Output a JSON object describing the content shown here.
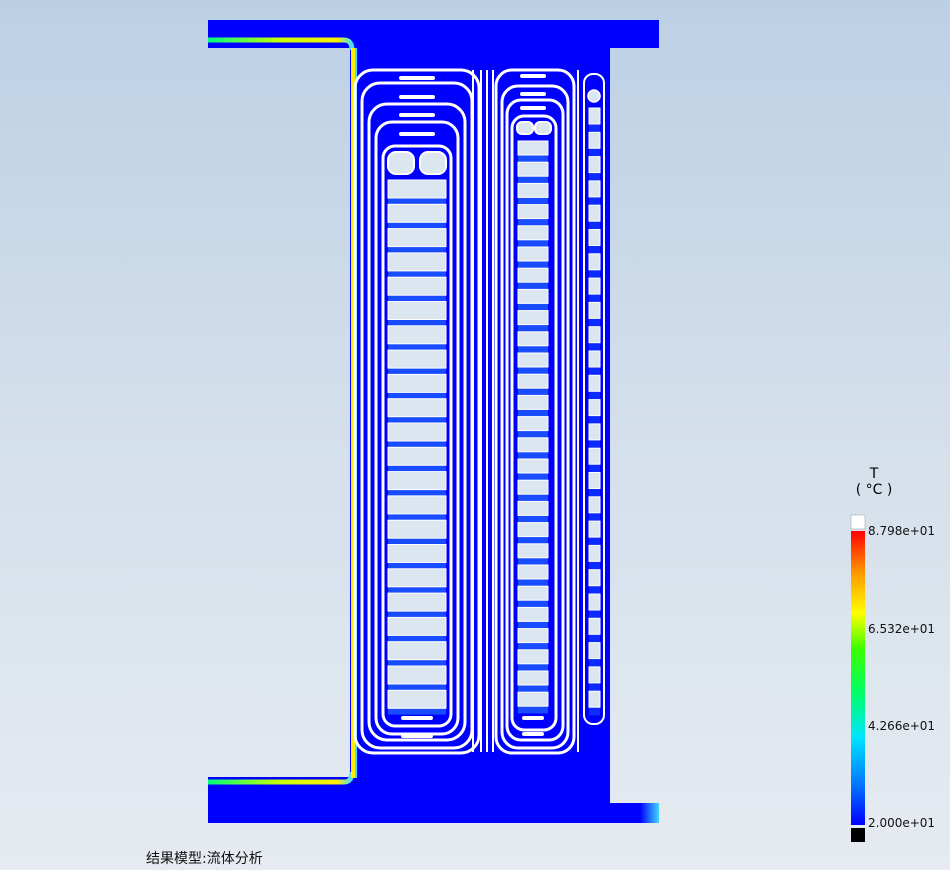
{
  "caption": "结果模型:流体分析",
  "legend": {
    "quantity": "T",
    "unit": "( °C )",
    "max_label": "8.798e+01",
    "mid_high_label": "6.532e+01",
    "mid_low_label": "4.266e+01",
    "min_label": "2.000e+01",
    "over_range_color": "#ffffff",
    "under_range_color": "#000000",
    "colormap": [
      "#0000ff",
      "#0078ff",
      "#00e6ff",
      "#00ff64",
      "#3cff00",
      "#ffff00",
      "#ff9600",
      "#ff0000"
    ]
  },
  "colors": {
    "fluid_domain": "#0000ff",
    "solid_walls": "#dce6f0",
    "plate_outline": "#ffffff",
    "hot_stream": "#ffee00",
    "warm_stream": "#40e0ff"
  }
}
